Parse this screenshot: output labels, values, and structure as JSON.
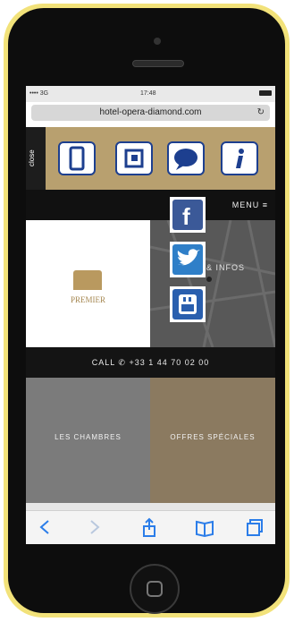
{
  "status": {
    "left": "•••• 3G",
    "time": "17:48"
  },
  "browser": {
    "url": "hotel-opera-diamond.com"
  },
  "quickbar": {
    "close_label": "close",
    "buttons": [
      {
        "icon": "mobile-phone-icon"
      },
      {
        "icon": "calendar-icon"
      },
      {
        "icon": "chat-bubble-icon"
      },
      {
        "icon": "info-icon"
      }
    ]
  },
  "header": {
    "menu_label": "MENU"
  },
  "social": {
    "icons": [
      "facebook-icon",
      "twitter-icon",
      "youtube-icon"
    ]
  },
  "logo": {
    "text": "PREMIER"
  },
  "map": {
    "infos_label": "& INFOS"
  },
  "call": {
    "label": "CALL",
    "phone": "+33 1 44 70 02 00"
  },
  "tiles": [
    {
      "label": "LES CHAMBRES"
    },
    {
      "label": "OFFRES SPÉCIALES"
    }
  ],
  "colors": {
    "gold": "#b8a06f",
    "frame": "#f2e27a",
    "blue": "#1d3f8f"
  }
}
